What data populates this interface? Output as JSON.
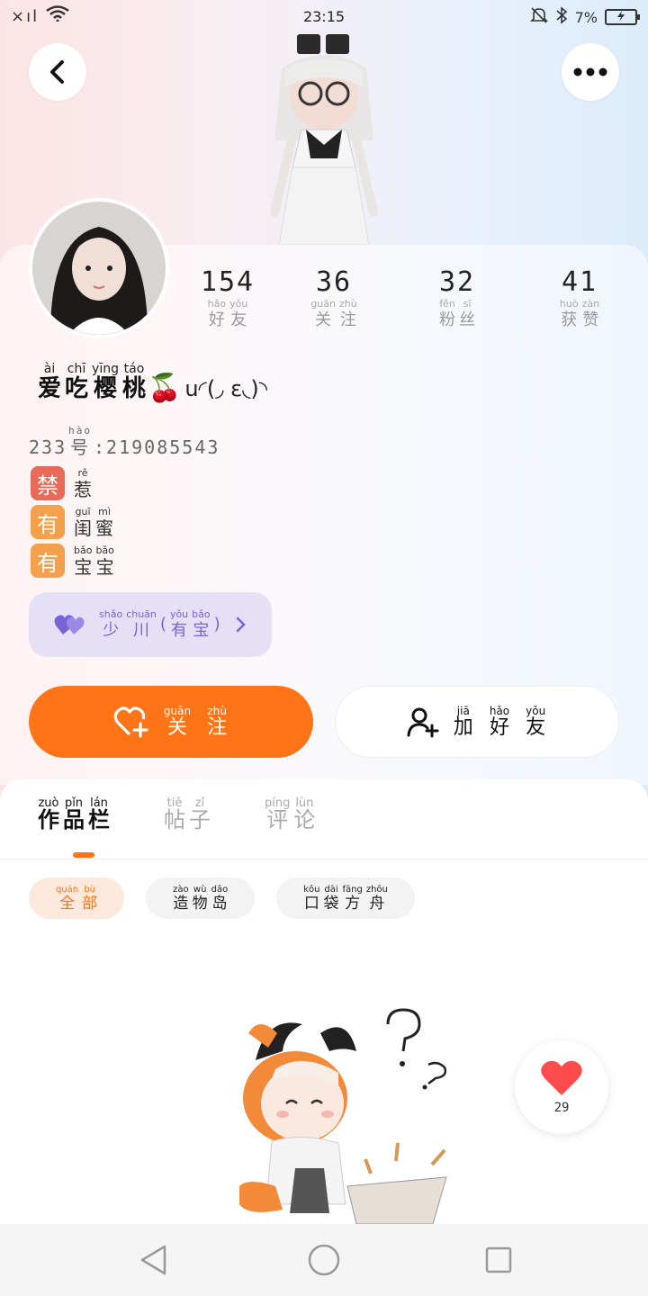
{
  "status_bar": {
    "time": "23:15",
    "signal": "×ıl",
    "battery": "7%"
  },
  "profile": {
    "stats": [
      {
        "value": "154",
        "label": [
          [
            "hǎo",
            "好"
          ],
          [
            "yǒu",
            "友"
          ]
        ]
      },
      {
        "value": "36",
        "label": [
          [
            "guān",
            "关"
          ],
          [
            "zhù",
            "注"
          ]
        ]
      },
      {
        "value": "32",
        "label": [
          [
            "fěn",
            "粉"
          ],
          [
            "sī",
            "丝"
          ]
        ]
      },
      {
        "value": "41",
        "label": [
          [
            "huò",
            "获"
          ],
          [
            "zàn",
            "赞"
          ]
        ]
      }
    ],
    "name": [
      [
        "ài",
        "爱"
      ],
      [
        "chī",
        "吃"
      ],
      [
        "yīng",
        "樱"
      ],
      [
        "táo",
        "桃"
      ]
    ],
    "name_emoji": "🍒",
    "name_kaomoji": "ս◜(◞ ε◟)◝",
    "uid_prefix": "233",
    "uid_label": [
      [
        "hào",
        "号"
      ]
    ],
    "uid_value": ":219085543",
    "tags": [
      {
        "badge": "禁",
        "color": "#e86a5a",
        "text": [
          [
            "rě",
            "惹"
          ]
        ]
      },
      {
        "badge": "有",
        "color": "#f5a04a",
        "text": [
          [
            "guī",
            "闺"
          ],
          [
            "mì",
            "蜜"
          ]
        ]
      },
      {
        "badge": "有",
        "color": "#f5a04a",
        "text": [
          [
            "bǎo",
            "宝"
          ],
          [
            "bǎo",
            "宝"
          ]
        ]
      }
    ],
    "relation": [
      [
        "shǎo",
        "少"
      ],
      [
        "chuān",
        "川"
      ],
      [
        "",
        "("
      ],
      [
        "yǒu",
        "有"
      ],
      [
        "bǎo",
        "宝"
      ],
      [
        "",
        ")"
      ]
    ],
    "follow_button": [
      [
        "guān",
        "关"
      ],
      [
        "zhù",
        "注"
      ]
    ],
    "friend_button": [
      [
        "jiā",
        "加"
      ],
      [
        "hǎo",
        "好"
      ],
      [
        "yǒu",
        "友"
      ]
    ]
  },
  "tabs": [
    {
      "label": [
        [
          "zuò",
          "作"
        ],
        [
          "pǐn",
          "品"
        ],
        [
          "lán",
          "栏"
        ]
      ],
      "active": true
    },
    {
      "label": [
        [
          "tiě",
          "帖"
        ],
        [
          "zǐ",
          "子"
        ]
      ],
      "active": false
    },
    {
      "label": [
        [
          "píng",
          "评"
        ],
        [
          "lùn",
          "论"
        ]
      ],
      "active": false
    }
  ],
  "chips": [
    {
      "label": [
        [
          "quán",
          "全"
        ],
        [
          "bù",
          "部"
        ]
      ],
      "active": true
    },
    {
      "label": [
        [
          "zào",
          "造"
        ],
        [
          "wù",
          "物"
        ],
        [
          "dǎo",
          "岛"
        ]
      ],
      "active": false
    },
    {
      "label": [
        [
          "kǒu",
          "口"
        ],
        [
          "dài",
          "袋"
        ],
        [
          "fāng",
          "方"
        ],
        [
          "zhōu",
          "舟"
        ]
      ],
      "active": false
    }
  ],
  "like_float": {
    "count": "29"
  },
  "colors": {
    "accent": "#ff7417",
    "relation_bg": "#e6e0f6",
    "relation_fg": "#7a63d6"
  }
}
